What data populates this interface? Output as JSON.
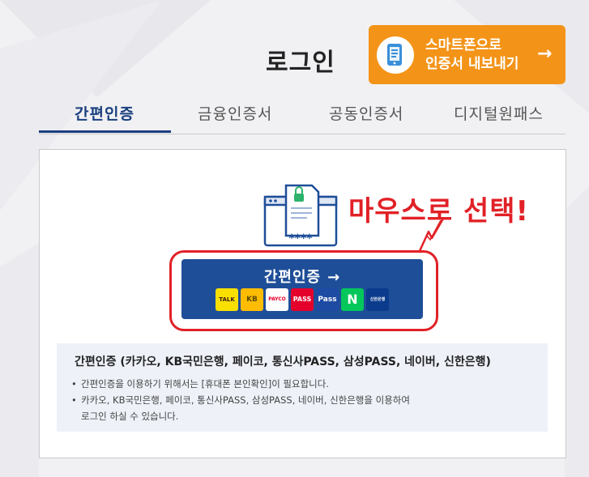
{
  "page": {
    "title": "로그인",
    "export_button": {
      "line1": "스마트폰으로",
      "line2": "인증서 내보내기",
      "arrow": "→",
      "icon": "smartphone-icon"
    }
  },
  "tabs": [
    {
      "label": "간편인증",
      "active": true
    },
    {
      "label": "금융인증서",
      "active": false
    },
    {
      "label": "공동인증서",
      "active": false
    },
    {
      "label": "디지털원패스",
      "active": false
    }
  ],
  "panel": {
    "illustration": {
      "masked_code": "****",
      "icon": "certificate-document-icon"
    },
    "annotation": "마우스로 선택!",
    "simple_auth_button": {
      "label": "간편인증",
      "arrow": "→"
    },
    "providers": [
      {
        "name": "TALK",
        "icon": "kakao-talk-icon",
        "color": "#f9e000"
      },
      {
        "name": "KB",
        "icon": "kb-bank-icon",
        "color": "#ffbc00"
      },
      {
        "name": "PAYCO",
        "icon": "payco-icon",
        "color": "#ffffff"
      },
      {
        "name": "PASS",
        "icon": "pass-icon",
        "color": "#e4002b"
      },
      {
        "name": "Pass",
        "icon": "samsung-pass-icon",
        "color": "#1d4aa3"
      },
      {
        "name": "N",
        "icon": "naver-icon",
        "color": "#03c75a"
      },
      {
        "name": "신한은행",
        "icon": "shinhan-bank-icon",
        "color": "#0b3b8c"
      }
    ],
    "info": {
      "title": "간편인증 (카카오, KB국민은행, 페이코, 통신사PASS, 삼성PASS, 네이버, 신한은행)",
      "bullet": "•",
      "lines": [
        "간편인증을 이용하기 위해서는 [휴대폰 본인확인]이 필요합니다.",
        "카카오, KB국민은행, 페이코, 통신사PASS, 삼성PASS, 네이버, 신한은행을 이용하여",
        "로그인 하실 수 있습니다."
      ]
    }
  },
  "colors": {
    "accent_navy": "#1a3f7f",
    "button_blue": "#1f4e98",
    "orange": "#f39419",
    "annotation_red": "#e12127"
  }
}
